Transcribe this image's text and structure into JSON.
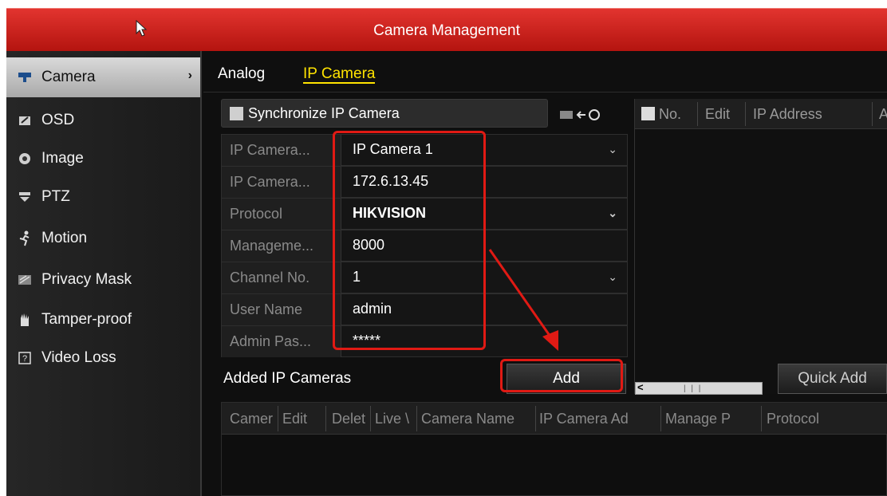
{
  "window": {
    "title": "Camera Management"
  },
  "sidebar": {
    "items": [
      {
        "label": "Camera",
        "icon": "camera-icon",
        "active": true
      },
      {
        "label": "OSD",
        "icon": "osd-icon"
      },
      {
        "label": "Image",
        "icon": "image-icon"
      },
      {
        "label": "PTZ",
        "icon": "ptz-icon"
      },
      {
        "label": "Motion",
        "icon": "motion-icon"
      },
      {
        "label": "Privacy Mask",
        "icon": "privacy-mask-icon"
      },
      {
        "label": "Tamper-proof",
        "icon": "tamper-proof-icon"
      },
      {
        "label": "Video Loss",
        "icon": "video-loss-icon"
      }
    ]
  },
  "tabs": {
    "analog": "Analog",
    "ip_camera": "IP Camera"
  },
  "sync": {
    "label": "Synchronize IP Camera"
  },
  "form": {
    "ip_camera_no": {
      "label": "IP Camera...",
      "value": "IP Camera 1"
    },
    "ip_camera_address": {
      "label": "IP Camera...",
      "value": "172.6.13.45"
    },
    "protocol": {
      "label": "Protocol",
      "value": "HIKVISION"
    },
    "management_port": {
      "label": "Manageme...",
      "value": "8000"
    },
    "channel_no": {
      "label": "Channel No.",
      "value": "1"
    },
    "user_name": {
      "label": "User Name",
      "value": "admin"
    },
    "admin_password": {
      "label": "Admin Pas...",
      "value": "*****"
    }
  },
  "right_table": {
    "headers": [
      "No.",
      "Edit",
      "IP Address",
      "A"
    ]
  },
  "added": {
    "label": "Added IP Cameras",
    "add_button": "Add",
    "quick_add_button": "Quick Add",
    "headers": [
      "Camer",
      "Edit",
      "Delet",
      "Live \\",
      "Camera Name",
      "IP Camera Ad",
      "Manage P",
      "Protocol"
    ]
  },
  "colors": {
    "accent_red": "#e01a14",
    "tab_active": "#ffe300"
  }
}
